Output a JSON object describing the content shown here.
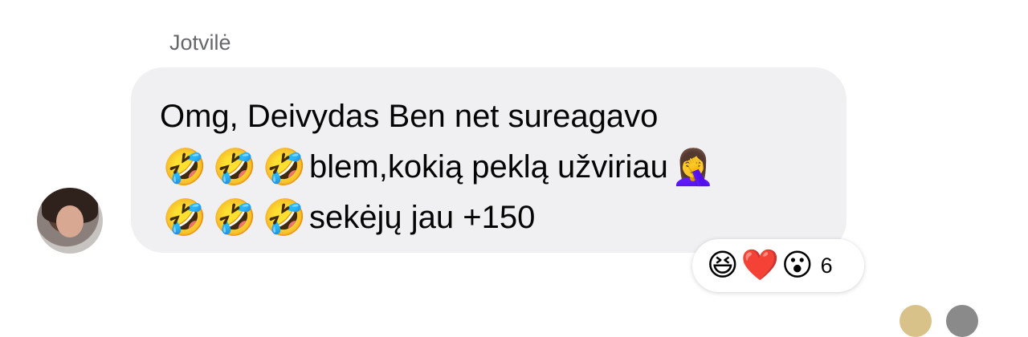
{
  "message": {
    "sender_name": "Jotvilė",
    "lines": [
      {
        "text": "Omg, Deivydas Ben net sureagavo"
      },
      {
        "prefix_emojis": [
          "🤣",
          "🤣",
          "🤣"
        ],
        "text": "blem,kokią peklą užviriau",
        "suffix_emoji": "🤦‍♀️"
      },
      {
        "prefix_emojis": [
          "🤣",
          "🤣",
          "🤣"
        ],
        "text": "sekėjų jau +150"
      }
    ]
  },
  "reactions": {
    "emojis": [
      "😆",
      "❤️",
      "😮"
    ],
    "count": "6"
  },
  "colors": {
    "bubble": "#f0f0f2",
    "sender_text": "#65676b",
    "message_text": "#050505"
  }
}
